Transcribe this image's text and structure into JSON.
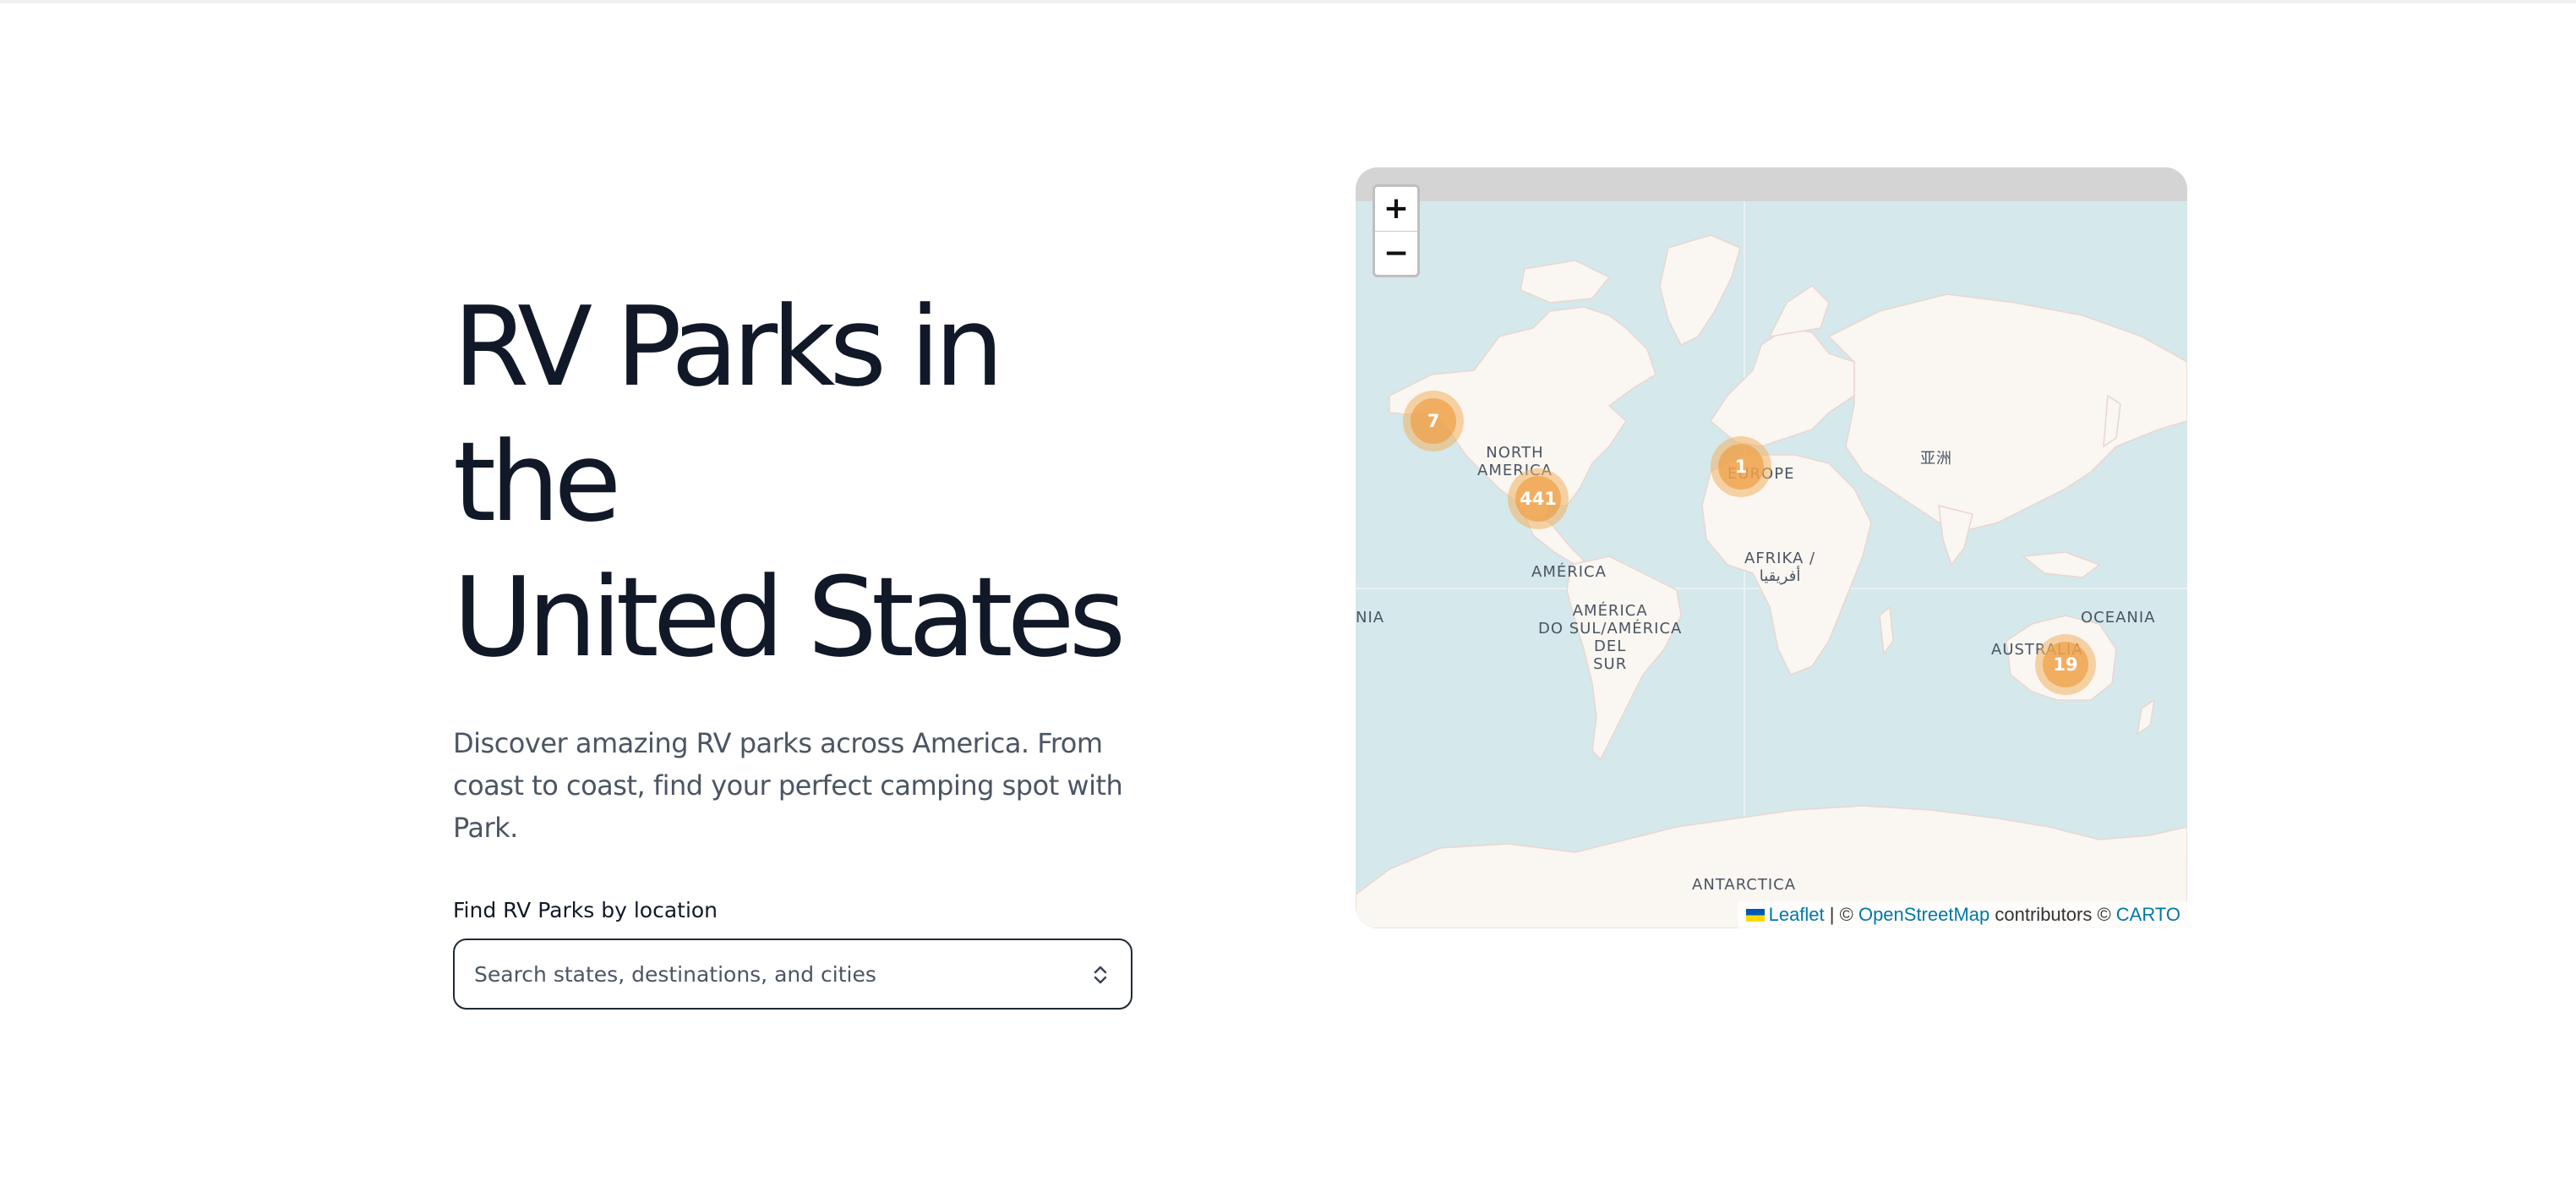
{
  "hero": {
    "title_line1": "RV Parks in the",
    "title_line2": "United States",
    "subtitle": "Discover amazing RV parks across America. From coast to coast, find your perfect camping spot with Park."
  },
  "search": {
    "label": "Find RV Parks by location",
    "placeholder": "Search states, destinations, and cities",
    "value": "",
    "icon": "chevron-up-down-icon"
  },
  "map": {
    "zoom_in_label": "+",
    "zoom_out_label": "−",
    "labels": {
      "north_america": "NORTH\nAMERICA",
      "america": "AMÉRICA",
      "south_america": "AMÉRICA\nDO SUL/AMÉRICA\nDEL\nSUR",
      "europe": "EUROPE",
      "africa": "AFRIKA /\nأفريقيا",
      "asia": "亚洲",
      "oceania": "OCEANIA",
      "australia": "AUSTRALIA",
      "antarctica": "ANTARCTICA",
      "edge_left": "NIA"
    },
    "clusters": [
      {
        "name": "alaska",
        "count": "7"
      },
      {
        "name": "usa",
        "count": "441"
      },
      {
        "name": "europe",
        "count": "1"
      },
      {
        "name": "australia",
        "count": "19"
      }
    ],
    "attribution": {
      "leaflet": "Leaflet",
      "separator": "| ©",
      "osm": "OpenStreetMap",
      "contributors": "contributors ©",
      "carto": "CARTO"
    },
    "colors": {
      "water": "#d5e8eb",
      "land": "#faf6f1",
      "cluster": "#f0a046"
    }
  }
}
